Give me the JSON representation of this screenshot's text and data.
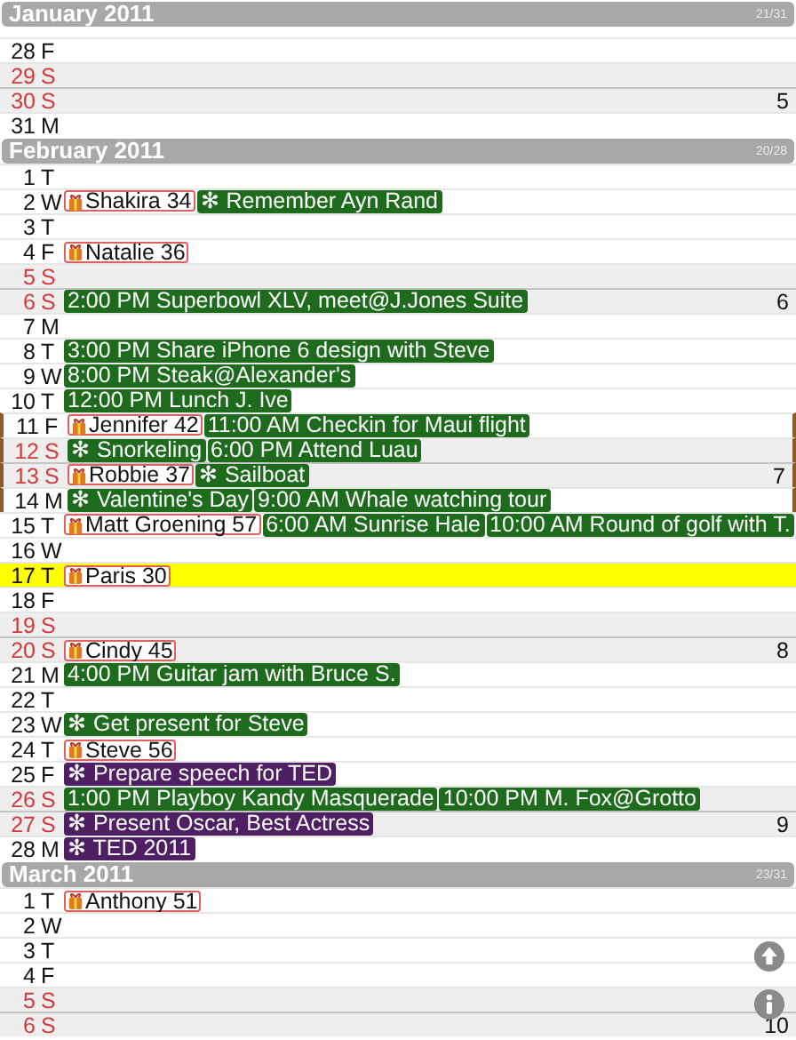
{
  "months": [
    {
      "title": "January 2011",
      "count": "21/31",
      "days": [
        {
          "day": "28",
          "weekday": "F",
          "weekend": false,
          "today": false,
          "bracketed": false
        },
        {
          "day": "29",
          "weekday": "S",
          "weekend": true,
          "today": false,
          "bracketed": false
        },
        {
          "day": "30",
          "weekday": "S",
          "weekend": true,
          "today": false,
          "bracketed": false,
          "week": "5"
        },
        {
          "day": "31",
          "weekday": "M",
          "weekend": false,
          "today": false,
          "bracketed": false
        }
      ]
    },
    {
      "title": "February 2011",
      "count": "20/28",
      "days": [
        {
          "day": "1",
          "weekday": "T",
          "weekend": false,
          "today": false,
          "bracketed": false
        },
        {
          "day": "2",
          "weekday": "W",
          "weekend": false,
          "today": false,
          "bracketed": false,
          "events": [
            {
              "kind": "birthday",
              "label": "Shakira 34"
            },
            {
              "kind": "event",
              "label": "✻ Remember Ayn Rand",
              "color": "#1e6b1e"
            }
          ]
        },
        {
          "day": "3",
          "weekday": "T",
          "weekend": false,
          "today": false,
          "bracketed": false
        },
        {
          "day": "4",
          "weekday": "F",
          "weekend": false,
          "today": false,
          "bracketed": false,
          "events": [
            {
              "kind": "birthday",
              "label": "Natalie 36"
            }
          ]
        },
        {
          "day": "5",
          "weekday": "S",
          "weekend": true,
          "today": false,
          "bracketed": false
        },
        {
          "day": "6",
          "weekday": "S",
          "weekend": true,
          "today": false,
          "bracketed": false,
          "week": "6",
          "events": [
            {
              "kind": "event",
              "label": "2:00 PM Superbowl XLV, meet@J.Jones Suite",
              "color": "#1e6b1e"
            }
          ]
        },
        {
          "day": "7",
          "weekday": "M",
          "weekend": false,
          "today": false,
          "bracketed": false
        },
        {
          "day": "8",
          "weekday": "T",
          "weekend": false,
          "today": false,
          "bracketed": false,
          "events": [
            {
              "kind": "event",
              "label": "3:00 PM Share iPhone 6 design with Steve",
              "color": "#1e6b1e"
            }
          ]
        },
        {
          "day": "9",
          "weekday": "W",
          "weekend": false,
          "today": false,
          "bracketed": false,
          "events": [
            {
              "kind": "event",
              "label": "8:00 PM Steak@Alexander's",
              "color": "#1e6b1e"
            }
          ]
        },
        {
          "day": "10",
          "weekday": "T",
          "weekend": false,
          "today": false,
          "bracketed": false,
          "events": [
            {
              "kind": "event",
              "label": "12:00 PM Lunch J. Ive",
              "color": "#1e6b1e"
            }
          ]
        },
        {
          "day": "11",
          "weekday": "F",
          "weekend": false,
          "today": false,
          "bracketed": true,
          "events": [
            {
              "kind": "birthday",
              "label": "Jennifer 42"
            },
            {
              "kind": "event",
              "label": "11:00 AM Checkin for Maui flight",
              "color": "#1e6b1e"
            }
          ]
        },
        {
          "day": "12",
          "weekday": "S",
          "weekend": true,
          "today": false,
          "bracketed": true,
          "events": [
            {
              "kind": "event",
              "label": "✻ Snorkeling",
              "color": "#1e6b1e"
            },
            {
              "kind": "event",
              "label": "6:00 PM Attend Luau",
              "color": "#1e6b1e"
            }
          ]
        },
        {
          "day": "13",
          "weekday": "S",
          "weekend": true,
          "today": false,
          "bracketed": true,
          "week": "7",
          "events": [
            {
              "kind": "birthday",
              "label": "Robbie 37"
            },
            {
              "kind": "event",
              "label": "✻ Sailboat",
              "color": "#1e6b1e"
            }
          ]
        },
        {
          "day": "14",
          "weekday": "M",
          "weekend": false,
          "today": false,
          "bracketed": true,
          "events": [
            {
              "kind": "event",
              "label": "✻ Valentine's Day",
              "color": "#1e6b1e"
            },
            {
              "kind": "event",
              "label": "9:00 AM Whale watching tour",
              "color": "#1e6b1e"
            }
          ]
        },
        {
          "day": "15",
          "weekday": "T",
          "weekend": false,
          "today": false,
          "bracketed": false,
          "events": [
            {
              "kind": "birthday",
              "label": "Matt Groening 57"
            },
            {
              "kind": "event",
              "label": "6:00 AM Sunrise Hale",
              "color": "#1e6b1e"
            },
            {
              "kind": "event",
              "label": "10:00 AM Round of golf with T.",
              "color": "#1e6b1e"
            }
          ]
        },
        {
          "day": "16",
          "weekday": "W",
          "weekend": false,
          "today": false,
          "bracketed": false
        },
        {
          "day": "17",
          "weekday": "T",
          "weekend": false,
          "today": true,
          "bracketed": false,
          "events": [
            {
              "kind": "birthday",
              "label": "Paris 30"
            }
          ]
        },
        {
          "day": "18",
          "weekday": "F",
          "weekend": false,
          "today": false,
          "bracketed": false
        },
        {
          "day": "19",
          "weekday": "S",
          "weekend": true,
          "today": false,
          "bracketed": false
        },
        {
          "day": "20",
          "weekday": "S",
          "weekend": true,
          "today": false,
          "bracketed": false,
          "week": "8",
          "events": [
            {
              "kind": "birthday",
              "label": "Cindy 45"
            }
          ]
        },
        {
          "day": "21",
          "weekday": "M",
          "weekend": false,
          "today": false,
          "bracketed": false,
          "events": [
            {
              "kind": "event",
              "label": "4:00 PM Guitar jam with Bruce S.",
              "color": "#1e6b1e"
            }
          ]
        },
        {
          "day": "22",
          "weekday": "T",
          "weekend": false,
          "today": false,
          "bracketed": false
        },
        {
          "day": "23",
          "weekday": "W",
          "weekend": false,
          "today": false,
          "bracketed": false,
          "events": [
            {
              "kind": "event",
              "label": "✻ Get present for Steve",
              "color": "#1e6b1e"
            }
          ]
        },
        {
          "day": "24",
          "weekday": "T",
          "weekend": false,
          "today": false,
          "bracketed": false,
          "events": [
            {
              "kind": "birthday",
              "label": "Steve 56"
            }
          ]
        },
        {
          "day": "25",
          "weekday": "F",
          "weekend": false,
          "today": false,
          "bracketed": false,
          "events": [
            {
              "kind": "event",
              "label": "✻ Prepare speech for TED",
              "color": "#4f1f63"
            }
          ]
        },
        {
          "day": "26",
          "weekday": "S",
          "weekend": true,
          "today": false,
          "bracketed": false,
          "events": [
            {
              "kind": "event",
              "label": "1:00 PM Playboy Kandy Masquerade",
              "color": "#1e6b1e"
            },
            {
              "kind": "event",
              "label": "10:00 PM M. Fox@Grotto",
              "color": "#1e6b1e"
            }
          ]
        },
        {
          "day": "27",
          "weekday": "S",
          "weekend": true,
          "today": false,
          "bracketed": false,
          "week": "9",
          "events": [
            {
              "kind": "event",
              "label": "✻ Present Oscar, Best Actress",
              "color": "#4f1f63"
            }
          ]
        },
        {
          "day": "28",
          "weekday": "M",
          "weekend": false,
          "today": false,
          "bracketed": false,
          "events": [
            {
              "kind": "event",
              "label": "✻ TED 2011",
              "color": "#4f1f63"
            }
          ]
        }
      ]
    },
    {
      "title": "March 2011",
      "count": "23/31",
      "days": [
        {
          "day": "1",
          "weekday": "T",
          "weekend": false,
          "today": false,
          "bracketed": false,
          "events": [
            {
              "kind": "birthday",
              "label": "Anthony 51"
            }
          ]
        },
        {
          "day": "2",
          "weekday": "W",
          "weekend": false,
          "today": false,
          "bracketed": false
        },
        {
          "day": "3",
          "weekday": "T",
          "weekend": false,
          "today": false,
          "bracketed": false
        },
        {
          "day": "4",
          "weekday": "F",
          "weekend": false,
          "today": false,
          "bracketed": false
        },
        {
          "day": "5",
          "weekday": "S",
          "weekend": true,
          "today": false,
          "bracketed": false
        },
        {
          "day": "6",
          "weekday": "S",
          "weekend": true,
          "today": false,
          "bracketed": false,
          "week": "10"
        }
      ]
    }
  ]
}
